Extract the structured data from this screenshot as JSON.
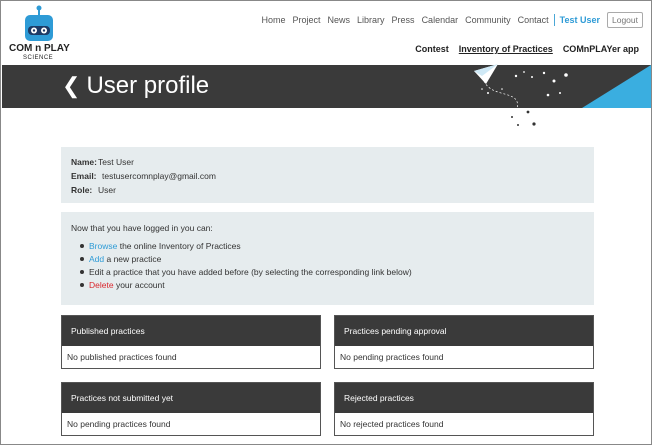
{
  "header": {
    "brand": "COM n PLAY",
    "brand_sub": "SCIENCE",
    "nav": [
      "Home",
      "Project",
      "News",
      "Library",
      "Press",
      "Calendar",
      "Community",
      "Contact"
    ],
    "user": "Test User",
    "logout": "Logout",
    "subnav": [
      "Contest",
      "Inventory of Practices",
      "COMnPLAYer app"
    ]
  },
  "banner": {
    "back_icon": "chevron-left-icon",
    "title": "User profile"
  },
  "profile": {
    "name_label": "Name:",
    "name": "Test User",
    "email_label": "Email:",
    "email": "testusercomnplay@gmail.com",
    "role_label": "Role:",
    "role": "User"
  },
  "actions": {
    "intro": "Now that you have logged in you can:",
    "browse_link": "Browse",
    "browse_rest": " the online Inventory of Practices",
    "add_link": "Add",
    "add_rest": " a new practice",
    "edit": "Edit a practice that you have added before (by selecting the corresponding link below)",
    "delete_link": "Delete",
    "delete_rest": " your account"
  },
  "cards": [
    {
      "title": "Published practices",
      "body": "No published practices found"
    },
    {
      "title": "Practices pending approval",
      "body": "No pending practices found"
    },
    {
      "title": "Practices not submitted yet",
      "body": "No pending practices found"
    },
    {
      "title": "Rejected practices",
      "body": "No rejected practices found"
    }
  ],
  "colors": {
    "accent": "#2e9bd6",
    "banner": "#3a3a3a",
    "panel": "#e6ecee",
    "danger": "#d9272e"
  }
}
